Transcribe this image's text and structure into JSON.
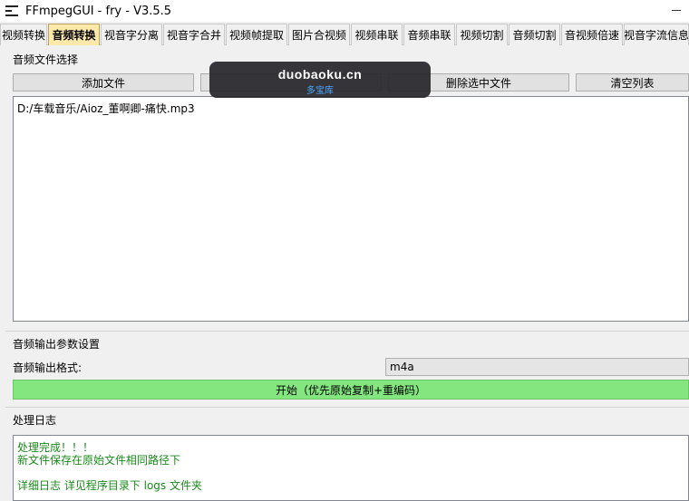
{
  "window": {
    "title": "FFmpegGUI - fry - V3.5.5",
    "menu_icon": "hamburger-menu-icon",
    "minimize_icon": "minimize-icon"
  },
  "tabs": [
    {
      "label": "视频转换",
      "active": false
    },
    {
      "label": "音频转换",
      "active": true
    },
    {
      "label": "视音字分离",
      "active": false
    },
    {
      "label": "视音字合并",
      "active": false
    },
    {
      "label": "视频帧提取",
      "active": false
    },
    {
      "label": "图片合视频",
      "active": false
    },
    {
      "label": "视频串联",
      "active": false
    },
    {
      "label": "音频串联",
      "active": false
    },
    {
      "label": "视频切割",
      "active": false
    },
    {
      "label": "音频切割",
      "active": false
    },
    {
      "label": "音视频倍速",
      "active": false
    },
    {
      "label": "视音字流信息",
      "active": false
    }
  ],
  "file_section": {
    "title": "音频文件选择",
    "add_button": "添加文件",
    "delete_button": "删除选中文件",
    "clear_button": "清空列表",
    "files": [
      "D:/车载音乐/Aioz_董啊卿-痛快.mp3"
    ]
  },
  "output_section": {
    "title": "音频输出参数设置",
    "format_label": "音频输出格式:",
    "format_value": "m4a",
    "start_button": "开始（优先原始复制+重编码）"
  },
  "log_section": {
    "title": "处理日志",
    "lines": [
      "处理完成！！！",
      "新文件保存在原始文件相同路径下",
      "",
      "详细日志 详见程序目录下 logs 文件夹"
    ]
  },
  "watermark": {
    "domain": "duobaoku.cn",
    "subtitle": "多宝库"
  },
  "colors": {
    "active_tab": "#fde9a9",
    "start_button": "#83e67f",
    "log_text": "#1a8a1a",
    "watermark_link": "#4da6ff"
  }
}
